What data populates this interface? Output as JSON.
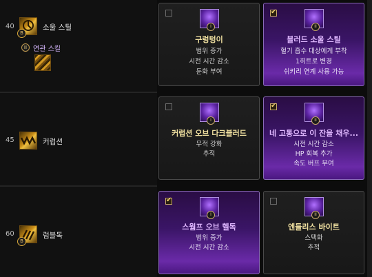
{
  "rows": [
    {
      "level": "40",
      "skill_name": "소울 스틸",
      "related_label": "연관 스킬",
      "cards": [
        {
          "selected": false,
          "tier": "I",
          "title": "구렁텅이",
          "lines": [
            "범위 증가",
            "시전 시간 감소",
            "둔화 부여"
          ]
        },
        {
          "selected": true,
          "tier": "II",
          "title": "블러드 소울 스틸",
          "lines": [
            "혈기 흡수 대상에게 부착",
            "1히트로 변경",
            "쉬키리 연계 사용 가능"
          ]
        }
      ]
    },
    {
      "level": "45",
      "skill_name": "커럽션",
      "cards": [
        {
          "selected": false,
          "tier": "I",
          "title": "커럽션 오브 다크블러드",
          "lines": [
            "무적 강화",
            "추적"
          ]
        },
        {
          "selected": true,
          "tier": "II",
          "title": "네 고통으로 이 잔을 채우...",
          "lines": [
            "시전 시간 감소",
            "HP 회복 추가",
            "속도 버프 부여"
          ]
        }
      ]
    },
    {
      "level": "60",
      "skill_name": "럼블독",
      "cards": [
        {
          "selected": true,
          "tier": "I",
          "title": "스웜프 오브 헬독",
          "lines": [
            "범위 증가",
            "시전 시간 감소"
          ]
        },
        {
          "selected": false,
          "tier": "II",
          "title": "엔들리스 바이트",
          "lines": [
            "스택화",
            "추적"
          ]
        }
      ]
    }
  ],
  "badges": {
    "skill_badge": "B",
    "related_badge": "II"
  },
  "colors": {
    "accent_purple": "#6a2aa8",
    "gold": "#d49a22"
  }
}
